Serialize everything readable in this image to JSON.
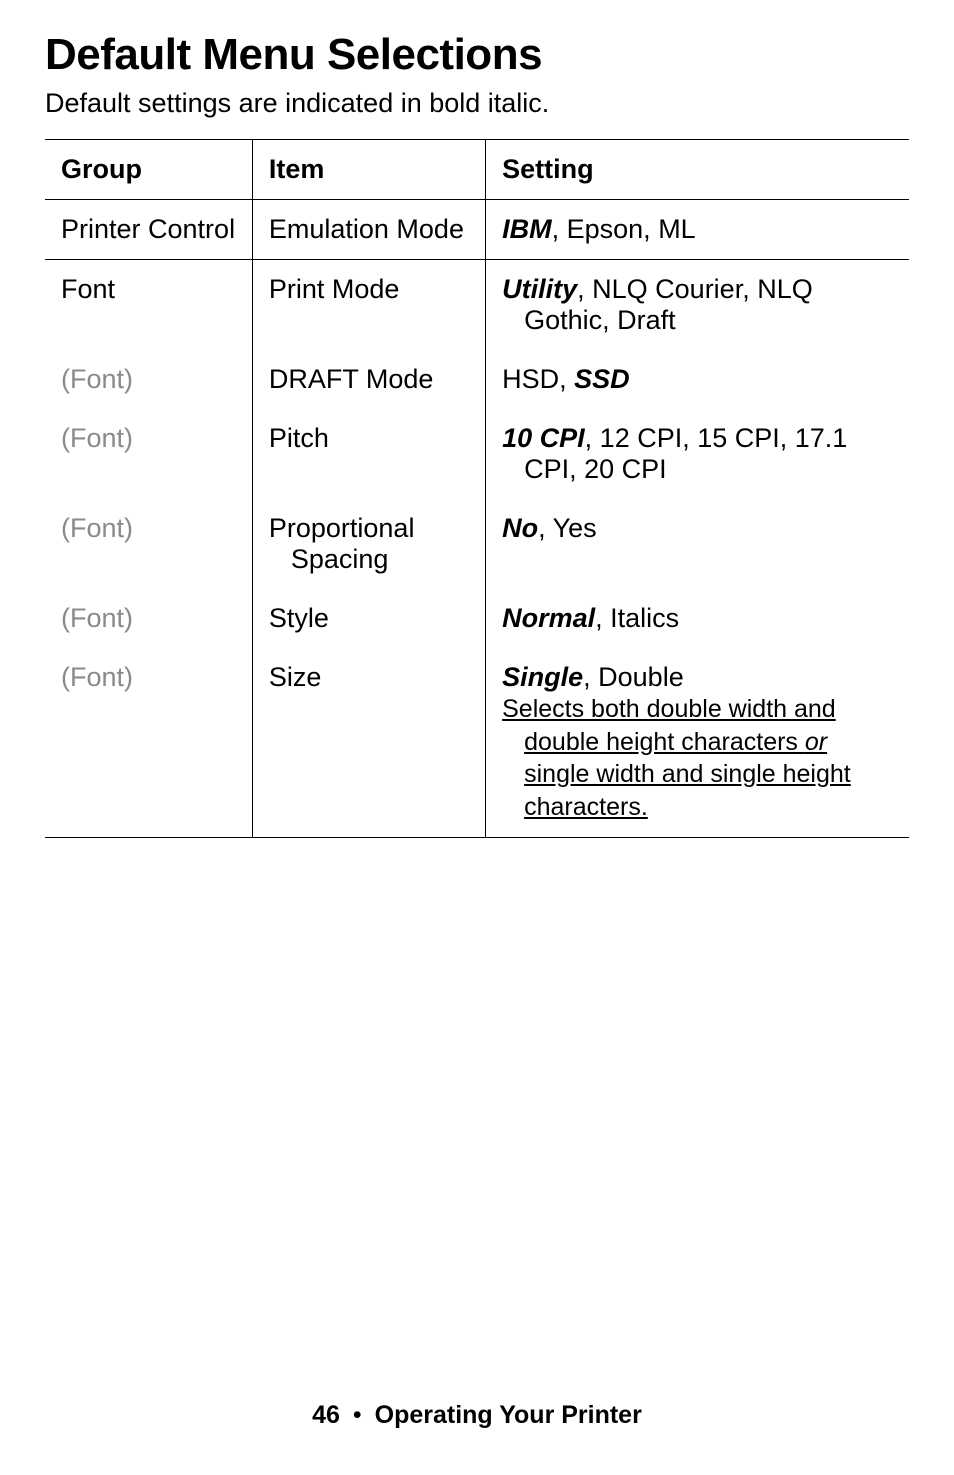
{
  "title": "Default Menu Selections",
  "subtitle": "Default settings are indicated in bold italic.",
  "headers": {
    "group": "Group",
    "item": "Item",
    "setting": "Setting"
  },
  "rows": {
    "r0": {
      "group": "Printer Control",
      "item": "Emulation Mode",
      "setting": {
        "bold": "IBM",
        "rest": ", Epson, ML"
      }
    },
    "r1": {
      "group": "Font",
      "item": "Print Mode",
      "setting": {
        "bold": "Utility",
        "rest1": ", NLQ Courier, NLQ",
        "rest2": "Gothic, Draft"
      }
    },
    "r2": {
      "group": "(Font)",
      "item": "DRAFT Mode",
      "setting": {
        "pre": "HSD, ",
        "bold": "SSD"
      }
    },
    "r3": {
      "group": "(Font)",
      "item": "Pitch",
      "setting": {
        "bold": "10 CPI",
        "rest1": ", 12 CPI, 15 CPI, 17.1",
        "rest2": "CPI, 20 CPI"
      }
    },
    "r4": {
      "group": "(Font)",
      "item1": "Proportional",
      "item2": "Spacing",
      "setting": {
        "bold": "No",
        "rest": ", Yes"
      }
    },
    "r5": {
      "group": "(Font)",
      "item": "Style",
      "setting": {
        "bold": "Normal",
        "rest": ", Italics"
      }
    },
    "r6": {
      "group": "(Font)",
      "item": "Size",
      "setting": {
        "bold": "Single",
        "rest": ", Double",
        "note1": "Selects both double width and ",
        "note2": "double height characters ",
        "note2it": "or ",
        "note3": "single width and single height ",
        "note4": "characters."
      }
    }
  },
  "footer": {
    "page": "46",
    "sep": "•",
    "section": "Operating Your Printer"
  }
}
